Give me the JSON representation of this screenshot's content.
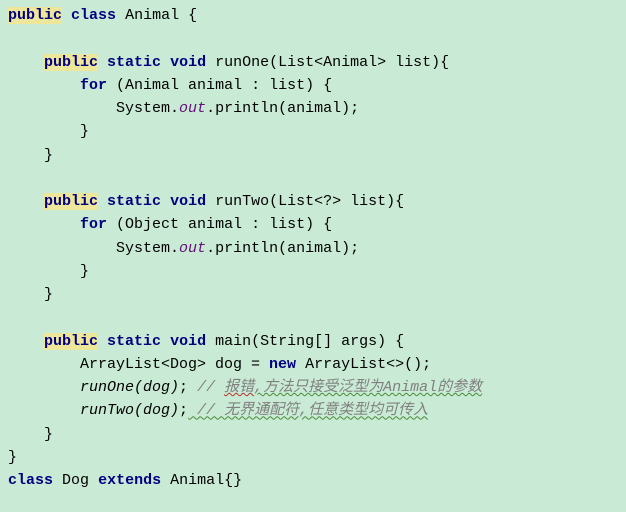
{
  "code": {
    "kw_public": "public",
    "kw_class": "class",
    "kw_static": "static",
    "kw_void": "void",
    "kw_for": "for",
    "kw_new": "new",
    "kw_extends": "extends",
    "cls_animal": "Animal",
    "cls_dog": "Dog",
    "method_runOne": "runOne",
    "method_runTwo": "runTwo",
    "method_main": "main",
    "param_list": "(List<Animal> list){",
    "param_list2": "(List<?> list){",
    "param_main": "(String[] args) {",
    "for_animal": "(Animal animal : list) {",
    "for_object": "(Object animal : list) {",
    "sys": "System.",
    "out": "out",
    "println": ".println(animal);",
    "brace_open": " {",
    "brace_close": "}",
    "arraylist_decl": "ArrayList<Dog> dog = ",
    "arraylist_new": " ArrayList<>();",
    "runOne_call": "runOne",
    "runTwo_call": "runTwo",
    "call_arg": "(dog)",
    "semi": ";",
    "comment1_prefix": " // ",
    "comment1_err": "报错",
    "comment1_rest": ",方法只接受泛型为Animal的参数",
    "comment2": " // 无界通配符,任意类型均可传入",
    "class_dog_body": "{}"
  }
}
